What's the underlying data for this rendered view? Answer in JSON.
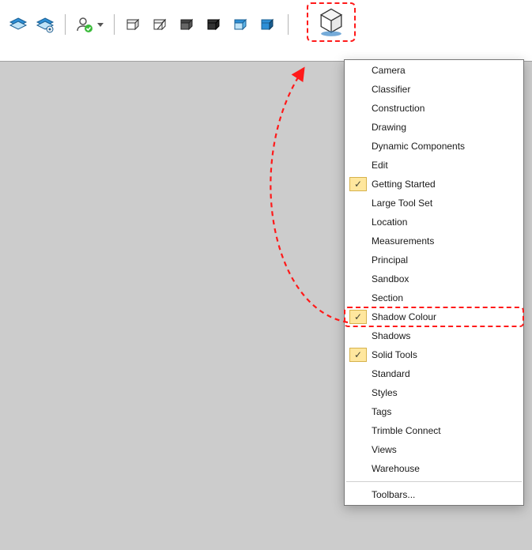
{
  "toolbar": {
    "icons": [
      "layers-visible-icon",
      "layers-settings-icon",
      "user-approved-icon",
      "section-plane-icon",
      "section-display-icon",
      "section-cut-icon",
      "section-fill-icon",
      "section-blue-a-icon",
      "section-blue-b-icon",
      "plugin-cube-icon"
    ],
    "user_has_dropdown": true
  },
  "menu": {
    "items": [
      {
        "label": "Camera",
        "checked": false
      },
      {
        "label": "Classifier",
        "checked": false
      },
      {
        "label": "Construction",
        "checked": false
      },
      {
        "label": "Drawing",
        "checked": false
      },
      {
        "label": "Dynamic Components",
        "checked": false
      },
      {
        "label": "Edit",
        "checked": false
      },
      {
        "label": "Getting Started",
        "checked": true
      },
      {
        "label": "Large Tool Set",
        "checked": false
      },
      {
        "label": "Location",
        "checked": false
      },
      {
        "label": "Measurements",
        "checked": false
      },
      {
        "label": "Principal",
        "checked": false
      },
      {
        "label": "Sandbox",
        "checked": false
      },
      {
        "label": "Section",
        "checked": false
      },
      {
        "label": "Shadow Colour",
        "checked": true,
        "highlighted": true
      },
      {
        "label": "Shadows",
        "checked": false
      },
      {
        "label": "Solid Tools",
        "checked": true
      },
      {
        "label": "Standard",
        "checked": false
      },
      {
        "label": "Styles",
        "checked": false
      },
      {
        "label": "Tags",
        "checked": false
      },
      {
        "label": "Trimble Connect",
        "checked": false
      },
      {
        "label": "Views",
        "checked": false
      },
      {
        "label": "Warehouse",
        "checked": false
      }
    ],
    "footer_label": "Toolbars..."
  },
  "callout": {
    "from_menu_item_index": 13,
    "to_toolbar_icon": "plugin-cube-icon",
    "color": "#ff1a1a"
  }
}
